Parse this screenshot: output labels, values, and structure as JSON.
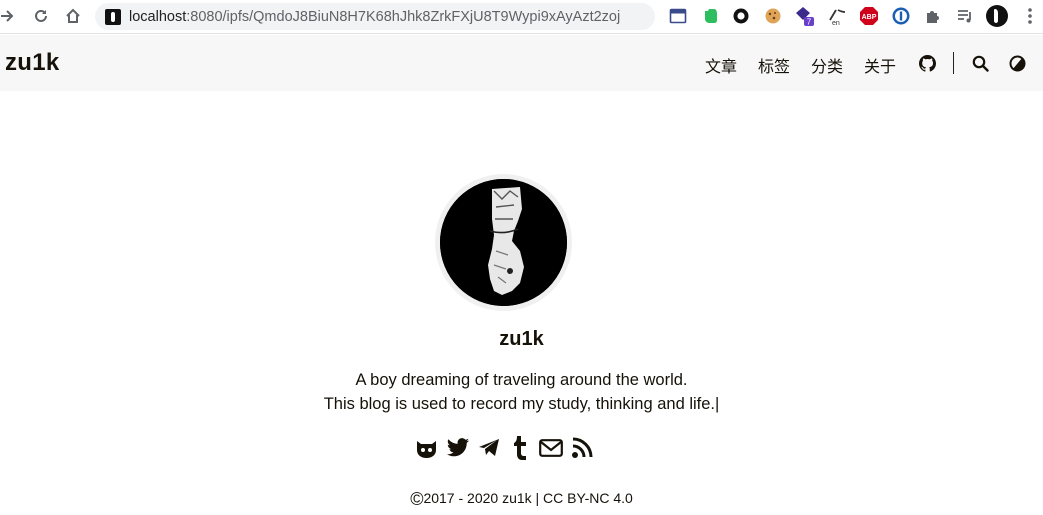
{
  "browser": {
    "url_host": "localhost",
    "url_path": ":8080/ipfs/QmdoJ8BiuN8H7K68hJhk8ZrkFXjU8T9Wypi9xAyAzt2zoj",
    "extensions": [
      "calendar-extension-icon",
      "evernote-icon",
      "circle-extension-icon",
      "cookie-icon",
      "badge-extension-icon",
      "translate-icon",
      "adblock-plus-icon",
      "password-manager-icon",
      "puzzle-icon",
      "playlist-icon",
      "profile-avatar-icon",
      "more-menu-icon"
    ],
    "extension_badge": "7",
    "adblock_label": "ABP",
    "translate_label": "en"
  },
  "header": {
    "brand": "zu1k",
    "menu": [
      "文章",
      "标签",
      "分类",
      "关于"
    ]
  },
  "profile": {
    "name": "zu1k",
    "subtitle_line1": "A boy dreaming of traveling around the world.",
    "subtitle_line2": "This blog is used to record my study, thinking and life.|"
  },
  "socials": [
    "github-icon",
    "twitter-icon",
    "telegram-icon",
    "tumblr-icon",
    "email-icon",
    "rss-icon"
  ],
  "footer": {
    "copyright_symbol": "©",
    "text": "2017 - 2020 zu1k | CC BY-NC 4.0"
  }
}
